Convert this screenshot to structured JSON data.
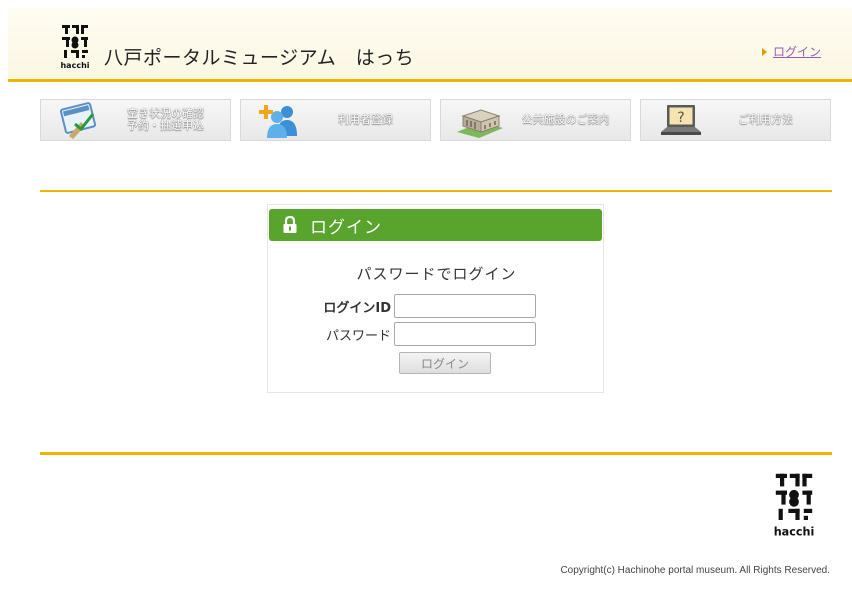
{
  "header": {
    "logo_text": "hacchi",
    "site_title": "八戸ポータルミュージアム　はっち",
    "login_link": "ログイン",
    "accent_color": "#f0b400"
  },
  "nav": {
    "items": [
      {
        "icon": "calendar-check-icon",
        "label_line1": "空き状況の確認",
        "label_line2": "予約・抽選申込"
      },
      {
        "icon": "add-user-icon",
        "label_line1": "利用者登録",
        "label_line2": ""
      },
      {
        "icon": "building-icon",
        "label_line1": "公共施設のご案内",
        "label_line2": ""
      },
      {
        "icon": "help-laptop-icon",
        "label_line1": "ご利用方法",
        "label_line2": ""
      }
    ]
  },
  "login_panel": {
    "title": "ログイン",
    "header_color": "#58a42d",
    "subtitle": "パスワードでログイン",
    "id_label": "ログインID",
    "id_value": "",
    "password_label": "パスワード",
    "password_value": "",
    "submit_label": "ログイン"
  },
  "footer": {
    "logo_text": "hacchi",
    "copyright": "Copyright(c) Hachinohe portal museum. All Rights Reserved."
  }
}
